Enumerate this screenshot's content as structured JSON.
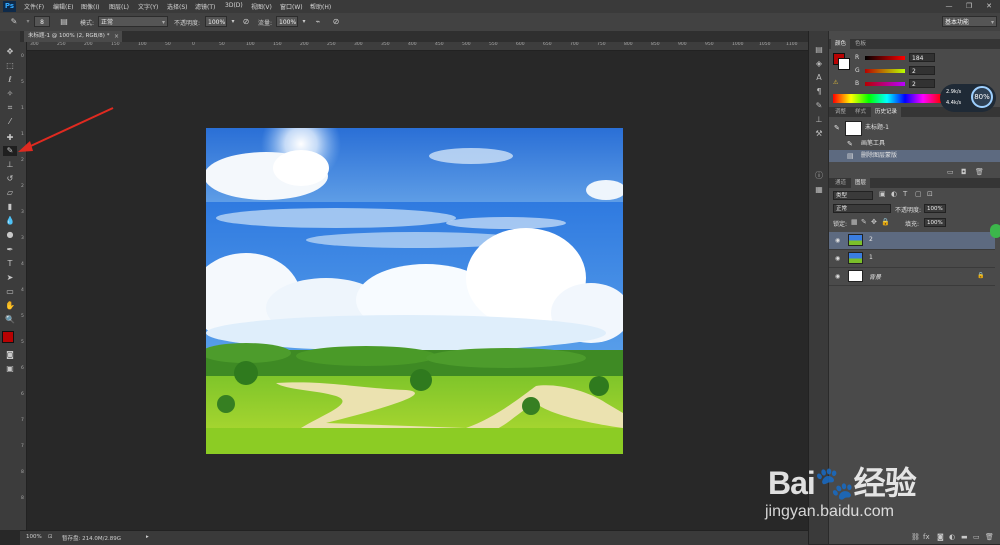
{
  "app": {
    "logo": "Ps",
    "window_buttons": [
      "—",
      "❐",
      "✕"
    ]
  },
  "menu": [
    "文件(F)",
    "编辑(E)",
    "图像(I)",
    "图层(L)",
    "文字(Y)",
    "选择(S)",
    "滤镜(T)",
    "3D(D)",
    "视图(V)",
    "窗口(W)",
    "帮助(H)"
  ],
  "options": {
    "brush_size": "8",
    "mode_label": "模式:",
    "mode_value": "正常",
    "opacity_label": "不透明度:",
    "opacity_value": "100%",
    "flow_label": "流量:",
    "flow_value": "100%",
    "workspace": "基本功能"
  },
  "document": {
    "tab_title": "未标题-1 @ 100% (2, RGB/8) *",
    "ruler_h": [
      "300",
      "250",
      "200",
      "150",
      "100",
      "50",
      "0",
      "50",
      "100",
      "150",
      "200",
      "250",
      "300",
      "350",
      "400",
      "450",
      "500",
      "550",
      "600",
      "650",
      "700",
      "750",
      "800",
      "850",
      "900",
      "950",
      "1000",
      "1050",
      "1100"
    ],
    "ruler_v": [
      "0",
      "5",
      "1",
      "1",
      "2",
      "2",
      "3",
      "3",
      "4",
      "4",
      "5",
      "5",
      "6",
      "6",
      "7",
      "7",
      "8",
      "8"
    ]
  },
  "status": {
    "zoom": "100%",
    "doc_size": "暂存盘: 214.0M/2.89G"
  },
  "color_panel": {
    "tabs": [
      "颜色",
      "色板"
    ],
    "channels": [
      {
        "label": "R",
        "value": "184"
      },
      {
        "label": "G",
        "value": "2"
      },
      {
        "label": "B",
        "value": "2"
      }
    ],
    "foreground": "#b80202"
  },
  "history_panel": {
    "tabs": [
      "调整",
      "样式",
      "历史记录"
    ],
    "snapshot": "未标题-1",
    "items": [
      "画笔工具",
      "删除图层蒙版"
    ]
  },
  "layers_panel": {
    "tabs": [
      "通道",
      "图层"
    ],
    "kind_filter": "类型",
    "blend_mode": "正常",
    "opacity_label": "不透明度:",
    "opacity_value": "100%",
    "lock_label": "锁定:",
    "fill_label": "填充:",
    "fill_value": "100%",
    "layers": [
      {
        "name": "2",
        "selected": true
      },
      {
        "name": "1",
        "selected": false
      },
      {
        "name": "背景",
        "selected": false
      }
    ]
  },
  "speed": {
    "up": "2.9k/s",
    "down": "4.4k/s",
    "percent": "80%"
  },
  "watermark": {
    "logo": "Bai🐾经验",
    "url": "jingyan.baidu.com"
  },
  "colors": {
    "accent_red": "#d9322b",
    "panel_bg": "#4a4a4a",
    "selected_layer": "#5d6a80"
  }
}
